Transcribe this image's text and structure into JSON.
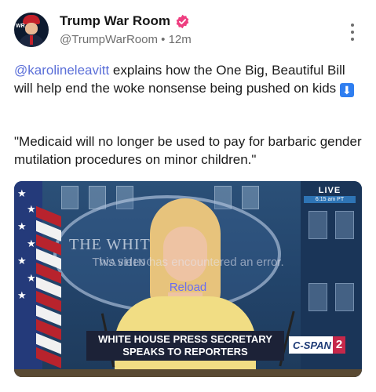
{
  "account": {
    "display_name": "Trump War Room",
    "handle": "@TrumpWarRoom",
    "separator": "•",
    "timestamp": "12m",
    "verified": true,
    "verified_color": "#ee3e80",
    "avatar_text": "WR"
  },
  "post": {
    "mention": "@karolineleavitt",
    "text_after_mention": " explains how the One Big, Beautiful Bill will help end the woke nonsense being pushed on kids ",
    "emoji": "⬇",
    "quote": "\"Medicaid will no longer be used to pay for barbaric gender mutilation procedures on minor children.\""
  },
  "video": {
    "live_label": "LIVE",
    "live_time": "6:15 am PT",
    "backdrop_text_1": "THE WHITE HOUSE",
    "backdrop_text_2": "WASHINGTON",
    "error_message": "This video has encountered an error.",
    "reload_label": "Reload",
    "chyron_line_1": "WHITE HOUSE PRESS SECRETARY",
    "chyron_line_2": "SPEAKS TO REPORTERS",
    "network_text": "C-SPAN",
    "network_num": "2"
  },
  "colors": {
    "mention": "#5b6fd8",
    "reload": "#6a6df2",
    "chyron_bg": "#1c2237",
    "cspan_red": "#c6284a"
  }
}
